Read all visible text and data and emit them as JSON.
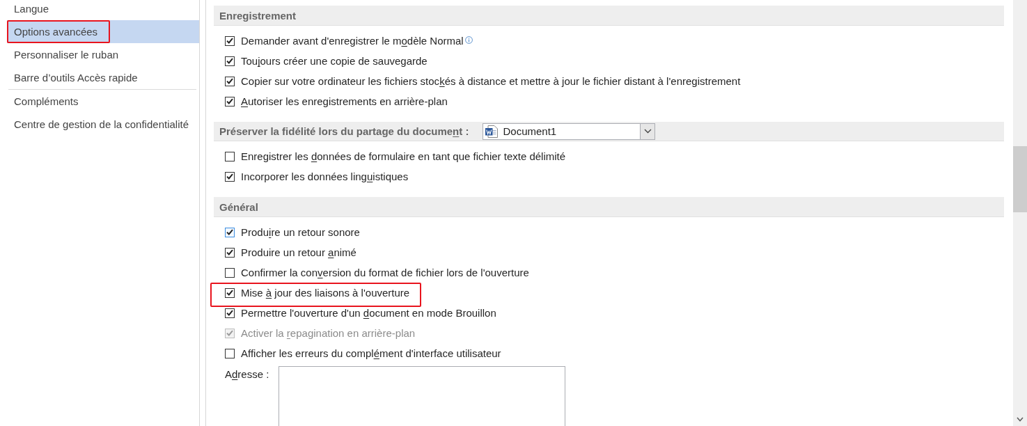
{
  "sidebar": {
    "groups": [
      {
        "items": [
          {
            "label": "Langue",
            "selected": false,
            "highlighted": false
          },
          {
            "label": "Options avancées",
            "selected": true,
            "highlighted": true
          },
          {
            "label": "Personnaliser le ruban",
            "selected": false,
            "highlighted": false
          },
          {
            "label": "Barre d’outils Accès rapide",
            "selected": false,
            "highlighted": false
          }
        ]
      },
      {
        "items": [
          {
            "label": "Compléments",
            "selected": false,
            "highlighted": false
          },
          {
            "label": "Centre de gestion de la confidentialité",
            "selected": false,
            "highlighted": false
          }
        ]
      }
    ]
  },
  "sections": [
    {
      "kind": "plain",
      "title": [
        {
          "text": "Enregistrement",
          "underlined": false
        }
      ],
      "options": [
        {
          "label": [
            {
              "text": "Demander avant d'enregistrer le m",
              "underlined": false
            },
            {
              "text": "o",
              "underlined": true
            },
            {
              "text": "dèle Normal",
              "underlined": false
            }
          ],
          "checked": true,
          "disabled": false,
          "focused": false,
          "info": true,
          "highlighted": false
        },
        {
          "label": [
            {
              "text": "Tou",
              "underlined": false
            },
            {
              "text": "j",
              "underlined": true
            },
            {
              "text": "ours créer une copie de sauvegarde",
              "underlined": false
            }
          ],
          "checked": true,
          "disabled": false,
          "focused": false,
          "info": false,
          "highlighted": false
        },
        {
          "label": [
            {
              "text": "Copier sur votre ordinateur les fichiers stoc",
              "underlined": false
            },
            {
              "text": "k",
              "underlined": true
            },
            {
              "text": "és à distance et mettre à jour le fichier distant à l'enregistrement",
              "underlined": false
            }
          ],
          "checked": true,
          "disabled": false,
          "focused": false,
          "info": false,
          "highlighted": false
        },
        {
          "label": [
            {
              "text": "A",
              "underlined": true
            },
            {
              "text": "utoriser les enregistrements en arrière-plan",
              "underlined": false
            }
          ],
          "checked": true,
          "disabled": false,
          "focused": false,
          "info": false,
          "highlighted": false
        }
      ]
    },
    {
      "kind": "with_select",
      "title": [
        {
          "text": "Préserver la fidélité lors du partage du docume",
          "underlined": false
        },
        {
          "text": "n",
          "underlined": true
        },
        {
          "text": "t :",
          "underlined": false
        }
      ],
      "select": {
        "value": "Document1"
      },
      "options": [
        {
          "label": [
            {
              "text": "Enregistrer les ",
              "underlined": false
            },
            {
              "text": "d",
              "underlined": true
            },
            {
              "text": "onnées de formulaire en tant que fichier texte délimité",
              "underlined": false
            }
          ],
          "checked": false,
          "disabled": false,
          "focused": false,
          "info": false,
          "highlighted": false
        },
        {
          "label": [
            {
              "text": "Incorporer les données ling",
              "underlined": false
            },
            {
              "text": "u",
              "underlined": true
            },
            {
              "text": "istiques",
              "underlined": false
            }
          ],
          "checked": true,
          "disabled": false,
          "focused": false,
          "info": false,
          "highlighted": false
        }
      ]
    },
    {
      "kind": "plain",
      "title": [
        {
          "text": "Général",
          "underlined": false
        }
      ],
      "options": [
        {
          "label": [
            {
              "text": "Produ",
              "underlined": false
            },
            {
              "text": "i",
              "underlined": true
            },
            {
              "text": "re un retour sonore",
              "underlined": false
            }
          ],
          "checked": true,
          "disabled": false,
          "focused": true,
          "info": false,
          "highlighted": false
        },
        {
          "label": [
            {
              "text": "Produire un retour ",
              "underlined": false
            },
            {
              "text": "a",
              "underlined": true
            },
            {
              "text": "nimé",
              "underlined": false
            }
          ],
          "checked": true,
          "disabled": false,
          "focused": false,
          "info": false,
          "highlighted": false
        },
        {
          "label": [
            {
              "text": "Confirmer la con",
              "underlined": false
            },
            {
              "text": "v",
              "underlined": true
            },
            {
              "text": "ersion du format de fichier lors de l'ouverture",
              "underlined": false
            }
          ],
          "checked": false,
          "disabled": false,
          "focused": false,
          "info": false,
          "highlighted": false
        },
        {
          "label": [
            {
              "text": "Mise ",
              "underlined": false
            },
            {
              "text": "à",
              "underlined": true
            },
            {
              "text": " jour des liaisons à l'ouverture",
              "underlined": false
            }
          ],
          "checked": true,
          "disabled": false,
          "focused": false,
          "info": false,
          "highlighted": true
        },
        {
          "label": [
            {
              "text": "Permettre l'ouverture d'un ",
              "underlined": false
            },
            {
              "text": "d",
              "underlined": true
            },
            {
              "text": "ocument en mode Brouillon",
              "underlined": false
            }
          ],
          "checked": true,
          "disabled": false,
          "focused": false,
          "info": false,
          "highlighted": false
        },
        {
          "label": [
            {
              "text": "Activer la ",
              "underlined": false
            },
            {
              "text": "r",
              "underlined": true
            },
            {
              "text": "epagination en arrière-plan",
              "underlined": false
            }
          ],
          "checked": true,
          "disabled": true,
          "focused": false,
          "info": false,
          "highlighted": false
        },
        {
          "label": [
            {
              "text": "Afficher les erreurs du compl",
              "underlined": false
            },
            {
              "text": "é",
              "underlined": true
            },
            {
              "text": "ment d'interface utilisateur",
              "underlined": false
            }
          ],
          "checked": false,
          "disabled": false,
          "focused": false,
          "info": false,
          "highlighted": false
        }
      ],
      "address": {
        "label": [
          {
            "text": "A",
            "underlined": false
          },
          {
            "text": "d",
            "underlined": true
          },
          {
            "text": "resse :",
            "underlined": false
          }
        ]
      }
    }
  ]
}
